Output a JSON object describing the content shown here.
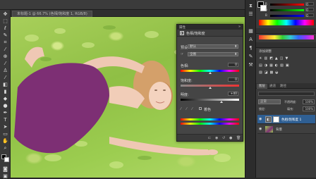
{
  "document_tab": {
    "label": "未标题-1 @ 66.7% (色相/饱和度 1, RGB/8)"
  },
  "tools": [
    "move-tool",
    "marquee-tool",
    "lasso-tool",
    "quick-select-tool",
    "crop-tool",
    "eyedropper-tool",
    "spot-heal-tool",
    "brush-tool",
    "clone-stamp-tool",
    "history-brush-tool",
    "eraser-tool",
    "gradient-tool",
    "blur-tool",
    "dodge-tool",
    "pen-tool",
    "type-tool",
    "path-select-tool",
    "shape-tool",
    "hand-tool",
    "zoom-tool"
  ],
  "dialog": {
    "title": "属性",
    "header": "色相/饱和度",
    "preset_label": "预设:",
    "preset_value": "默认",
    "channel_value": "全图",
    "hue_label": "色相:",
    "hue_value": "0",
    "saturation_label": "饱和度:",
    "saturation_value": "0",
    "lightness_label": "明度:",
    "lightness_value": "+40",
    "colorize_label": "着色",
    "lightness_fraction": 0.7
  },
  "right_panel": {
    "color_values": [
      "0",
      "0",
      "0"
    ],
    "adjustments_title": "添加调整",
    "layers_tabs": [
      "图层",
      "通道",
      "路径"
    ],
    "blend_mode": "正常",
    "opacity_label": "不透明度:",
    "opacity_value": "100%",
    "lock_label": "锁定:",
    "fill_label": "填充:",
    "fill_value": "100%",
    "layers": [
      {
        "name": "色相/饱和度 1",
        "selected": true
      },
      {
        "name": "背景",
        "selected": false
      }
    ]
  },
  "colors": {
    "accent": "#2f5f93",
    "panel": "#3a3a3a"
  }
}
